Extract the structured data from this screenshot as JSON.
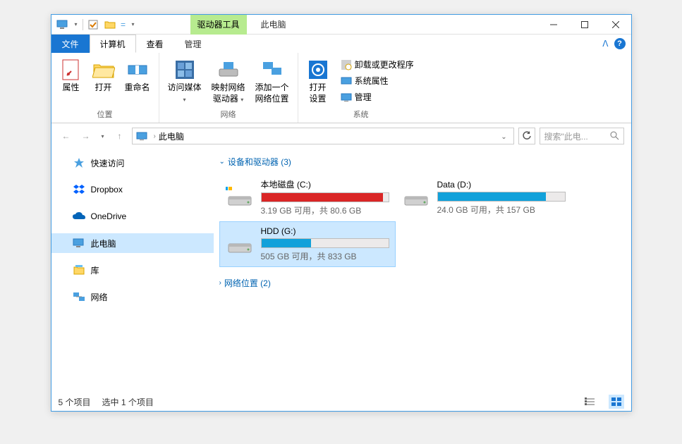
{
  "window": {
    "title": "此电脑",
    "contextual_tab": "驱动器工具"
  },
  "tabs": {
    "file": "文件",
    "computer": "计算机",
    "view": "查看",
    "manage": "管理"
  },
  "ribbon": {
    "group_location": "位置",
    "group_network": "网络",
    "group_system": "系统",
    "properties": "属性",
    "open": "打开",
    "rename": "重命名",
    "access_media": "访问媒体",
    "map_drive": "映射网络\n驱动器",
    "add_location": "添加一个\n网络位置",
    "open_settings": "打开\n设置",
    "uninstall": "卸载或更改程序",
    "sys_props": "系统属性",
    "manage": "管理"
  },
  "addressbar": {
    "location": "此电脑"
  },
  "search": {
    "placeholder": "搜索\"此电..."
  },
  "sidebar": {
    "quick_access": "快速访问",
    "dropbox": "Dropbox",
    "onedrive": "OneDrive",
    "this_pc": "此电脑",
    "libraries": "库",
    "network": "网络"
  },
  "sections": {
    "devices_drives": "设备和驱动器 (3)",
    "network_locations": "网络位置 (2)"
  },
  "drives": [
    {
      "name": "本地磁盘 (C:)",
      "stats": "3.19 GB 可用，共 80.6 GB",
      "fill_pct": 96,
      "fill_color": "#da2626",
      "selected": false,
      "has_win_logo": true
    },
    {
      "name": "Data (D:)",
      "stats": "24.0 GB 可用，共 157 GB",
      "fill_pct": 85,
      "fill_color": "#12a1da",
      "selected": false,
      "has_win_logo": false
    },
    {
      "name": "HDD (G:)",
      "stats": "505 GB 可用，共 833 GB",
      "fill_pct": 39,
      "fill_color": "#12a1da",
      "selected": true,
      "has_win_logo": false
    }
  ],
  "status": {
    "item_count": "5 个项目",
    "selected": "选中 1 个项目"
  }
}
